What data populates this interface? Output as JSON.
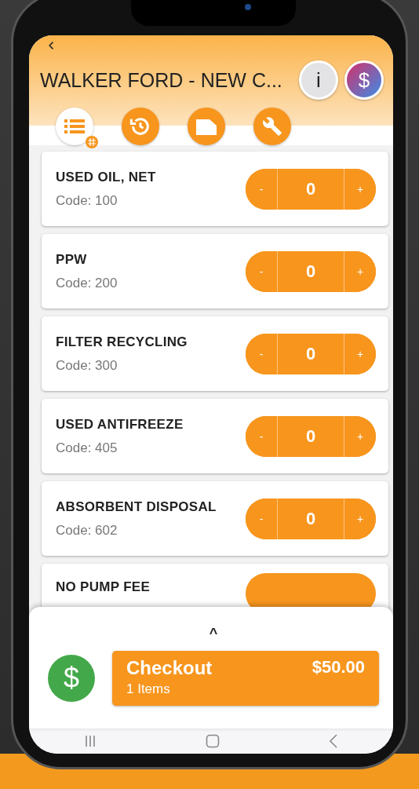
{
  "header": {
    "title": "WALKER FORD - NEW C...",
    "info_label": "i",
    "account_label": "$"
  },
  "tabs": [
    {
      "kind": "list",
      "selected": true
    },
    {
      "kind": "history",
      "selected": false
    },
    {
      "kind": "document",
      "selected": false
    },
    {
      "kind": "wrench",
      "selected": false
    }
  ],
  "items": [
    {
      "name": "USED OIL, NET",
      "code": "Code: 100",
      "minus": "-",
      "quantity": "0",
      "plus": "+"
    },
    {
      "name": "PPW",
      "code": "Code: 200",
      "minus": "-",
      "quantity": "0",
      "plus": "+"
    },
    {
      "name": "FILTER RECYCLING",
      "code": "Code: 300",
      "minus": "-",
      "quantity": "0",
      "plus": "+"
    },
    {
      "name": "USED ANTIFREEZE",
      "code": "Code: 405",
      "minus": "-",
      "quantity": "0",
      "plus": "+"
    },
    {
      "name": "ABSORBENT DISPOSAL",
      "code": "Code: 602",
      "minus": "-",
      "quantity": "0",
      "plus": "+"
    },
    {
      "name": "NO PUMP FEE"
    }
  ],
  "checkout": {
    "caret": "^",
    "money_label": "$",
    "title": "Checkout",
    "count": "1 Items",
    "total": "$50.00"
  }
}
